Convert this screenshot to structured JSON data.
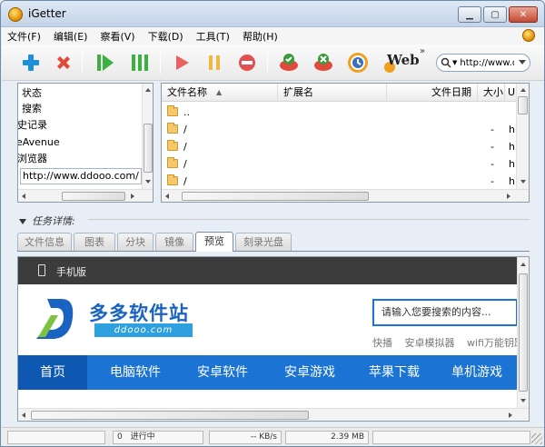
{
  "window": {
    "title": "iGetter"
  },
  "menu": {
    "items": [
      "文件(F)",
      "编辑(E)",
      "察看(V)",
      "下载(D)",
      "工具(T)",
      "帮助(H)"
    ]
  },
  "toolbar": {
    "buttons": [
      {
        "name": "add-icon",
        "color": "#1e8fd8"
      },
      {
        "name": "delete-icon",
        "color": "#e04a3a"
      },
      {
        "name": "start-all-icon",
        "color": "#3cb040"
      },
      {
        "name": "pause-all-icon",
        "color": "#3cb040"
      },
      {
        "name": "start-icon",
        "color": "#e86060"
      },
      {
        "name": "pause-icon",
        "color": "#f0b840"
      },
      {
        "name": "stop-icon",
        "color": "#e05050"
      },
      {
        "name": "connect-icon",
        "color": "#3a9a3a"
      },
      {
        "name": "disconnect-icon",
        "color": "#3a9a3a"
      },
      {
        "name": "schedule-icon",
        "color": "#f0a020"
      },
      {
        "name": "web-icon",
        "color": "#f0a020"
      }
    ],
    "web_label": "Web",
    "more_label": "»",
    "url_value": "http://www.dc"
  },
  "tree": {
    "items": [
      "状态",
      "搜索",
      "历史记录",
      "eAvenue",
      "点浏览器"
    ],
    "url_value": "http://www.ddooo.com/"
  },
  "list": {
    "columns": [
      "文件名称",
      "扩展名",
      "文件日期",
      "大小",
      "U"
    ],
    "rows": [
      {
        "name": "..",
        "size": "",
        "h": ""
      },
      {
        "name": "/",
        "size": "-",
        "h": "h"
      },
      {
        "name": "/",
        "size": "-",
        "h": "h"
      },
      {
        "name": "/",
        "size": "-",
        "h": "h"
      },
      {
        "name": "/",
        "size": "-",
        "h": "h"
      }
    ]
  },
  "detail": {
    "label": "任务详情:",
    "tabs": [
      "文件信息",
      "图表",
      "分块",
      "镜像",
      "预览",
      "刻录光盘"
    ],
    "active_tab": 4
  },
  "preview": {
    "mobile_label": "手机版",
    "logo_cn": "多多软件站",
    "logo_en": "ddooo.com",
    "search_placeholder": "请输入您要搜索的内容...",
    "hot_links": [
      "快播",
      "安卓模拟器",
      "wifi万能钥匙"
    ],
    "nav": [
      "首页",
      "电脑软件",
      "安卓软件",
      "安卓游戏",
      "苹果下载",
      "单机游戏"
    ],
    "nav_active": 0,
    "accent": "#1b74d4"
  },
  "status": {
    "count": "0",
    "state": "进行中",
    "speed": "-- KB/s",
    "total": "2.39 MB"
  }
}
